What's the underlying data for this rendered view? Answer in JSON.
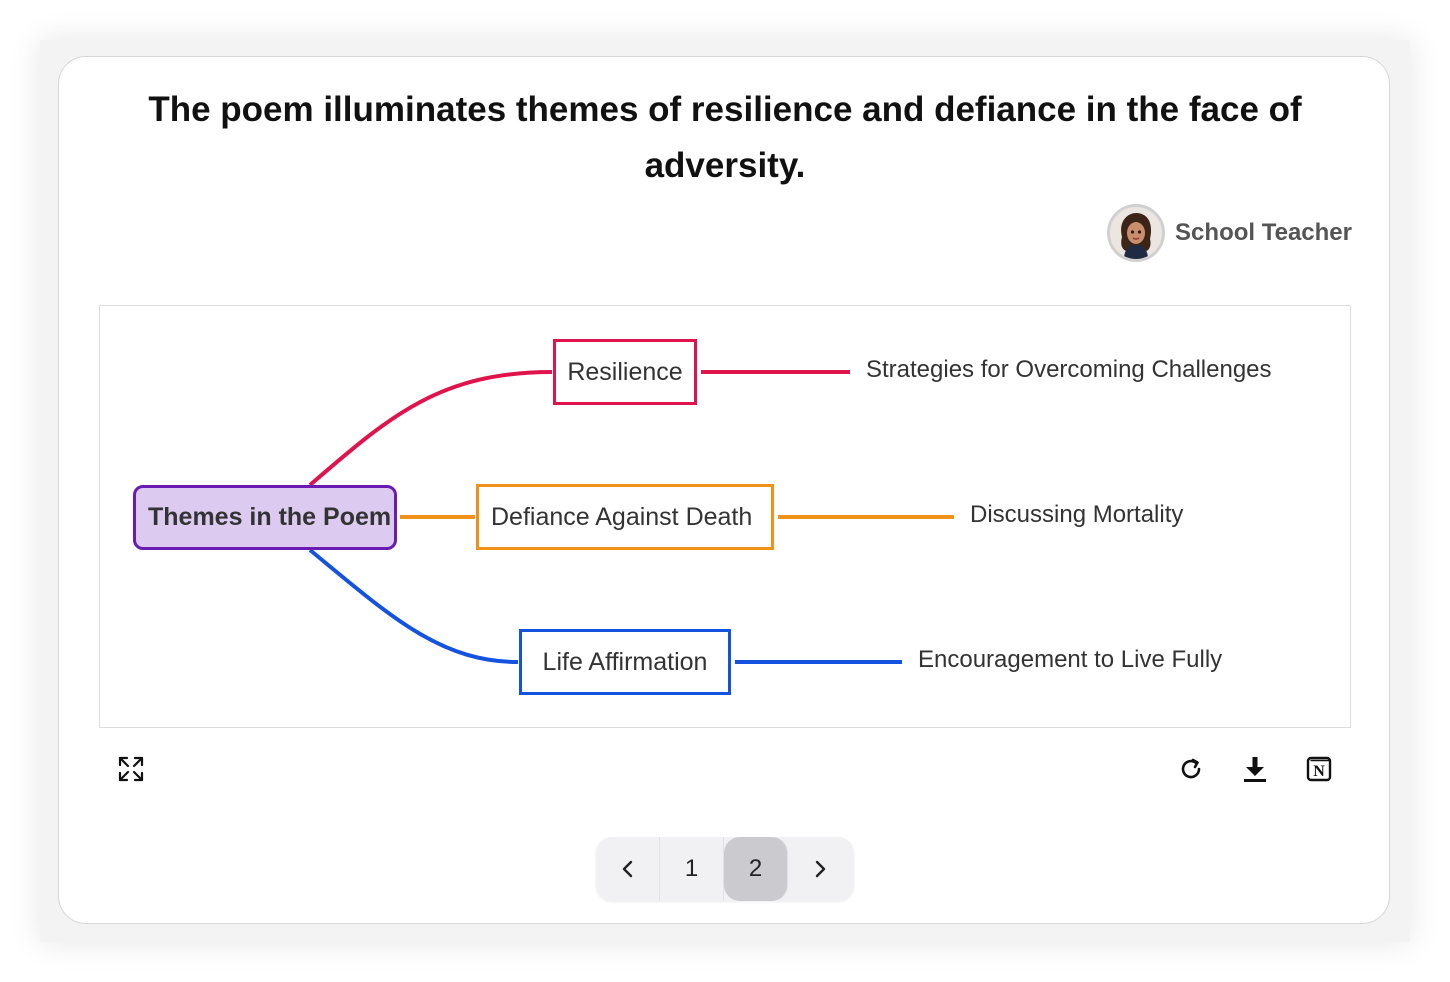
{
  "card": {
    "title": "The poem illuminates themes of resilience and defiance in the face of adversity.",
    "author": {
      "name": "School Teacher",
      "avatar_icon": "avatar-icon"
    }
  },
  "mindmap": {
    "root": {
      "label": "Themes in the Poem",
      "color": "#6a1bb3",
      "fill": "#dccaf0"
    },
    "branches": [
      {
        "label": "Resilience",
        "color": "#e0144c",
        "child": "Strategies for Overcoming Challenges"
      },
      {
        "label": "Defiance Against Death",
        "color": "#f0921a",
        "child": "Discussing Mortality"
      },
      {
        "label": "Life Affirmation",
        "color": "#1452e0",
        "child": "Encouragement to Live Fully"
      }
    ]
  },
  "toolbar": {
    "left": [
      "expand-icon"
    ],
    "right": [
      "refresh-icon",
      "download-icon",
      "notion-icon"
    ]
  },
  "pagination": {
    "prev_icon": "chevron-left-icon",
    "pages": [
      "1",
      "2"
    ],
    "current": "2",
    "next_icon": "chevron-right-icon"
  }
}
